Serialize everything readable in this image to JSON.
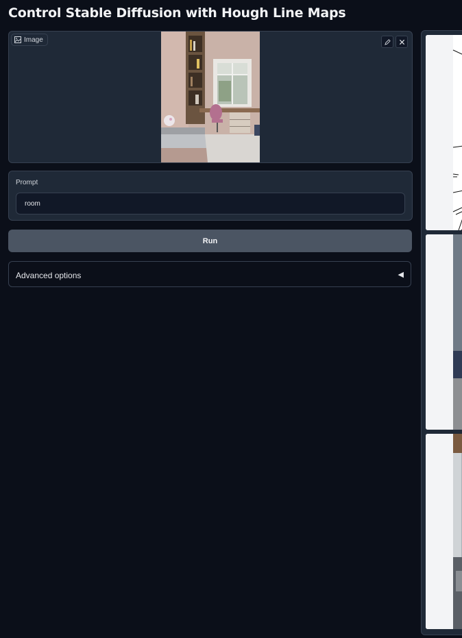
{
  "header": {
    "title": "Control Stable Diffusion with Hough Line Maps"
  },
  "image_input": {
    "label": "Image",
    "icon": "image-icon",
    "edit_icon": "pencil-icon",
    "clear_icon": "close-icon"
  },
  "prompt": {
    "label": "Prompt",
    "value": "room"
  },
  "run_button": {
    "label": "Run"
  },
  "advanced": {
    "label": "Advanced options",
    "caret": "◀"
  },
  "gallery": {
    "count": 3
  }
}
